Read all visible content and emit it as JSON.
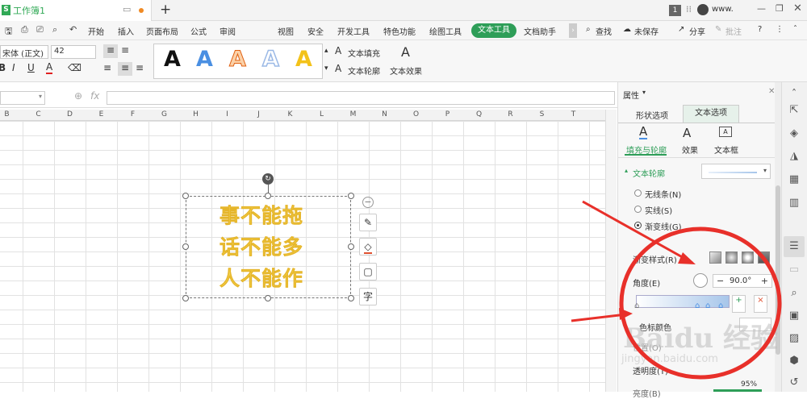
{
  "titlebar": {
    "logo": "S",
    "doc_title": "工作簿1",
    "new_tab": "+",
    "badge": "1",
    "user": "www.",
    "min": "—",
    "max": "❐",
    "close": "✕"
  },
  "menu": {
    "items": [
      "开始",
      "插入",
      "页面布局",
      "公式",
      "审阅",
      "视图",
      "安全",
      "开发工具",
      "特色功能",
      "绘图工具",
      "文本工具",
      "文档助手"
    ],
    "search": "查找",
    "save_status": "未保存",
    "share": "分享",
    "comment": "批注",
    "help": "?"
  },
  "ribbon": {
    "font_name": "宋体 (正文)",
    "font_size": "42",
    "bold": "B",
    "italic": "I",
    "underline": "U",
    "font_color": "A",
    "styles": [
      "A",
      "A",
      "A",
      "A",
      "A"
    ],
    "style_colors": [
      "#111111",
      "#4a8fe2",
      "#f2904a",
      "#9bb9e6",
      "#f3c21a"
    ],
    "text_fill": "文本填充",
    "text_outline": "文本轮廓",
    "text_effect": "文本效果"
  },
  "formula": {
    "fx": "fx"
  },
  "columns": [
    "B",
    "C",
    "D",
    "E",
    "F",
    "G",
    "H",
    "I",
    "J",
    "K",
    "L",
    "M",
    "N",
    "O",
    "P",
    "Q",
    "R",
    "S",
    "T"
  ],
  "textbox": {
    "lines": [
      "事不能拖",
      "话不能多",
      "人不能作"
    ],
    "text_color": "#f5d24c"
  },
  "pane": {
    "title": "属性",
    "tabs": [
      "形状选项",
      "文本选项"
    ],
    "subtabs": [
      "填充与轮廓",
      "效果",
      "文本框"
    ],
    "section": "文本轮廓",
    "options": [
      "无线条(N)",
      "实线(S)",
      "渐变线(G)"
    ],
    "selected_option": "渐变线(G)",
    "gradient_style": "渐变样式(R)",
    "angle_label": "角度(E)",
    "angle_value": "90.0°",
    "color_label": "色标颜色",
    "position_label": "位置(O)",
    "transparency_label": "透明度(T)",
    "brightness_label": "亮度(B)",
    "brightness_value": "95%"
  },
  "watermark": {
    "text": "Baidu 经验",
    "url": "jingyan.baidu.com"
  },
  "annotation_color": "#e8302a"
}
